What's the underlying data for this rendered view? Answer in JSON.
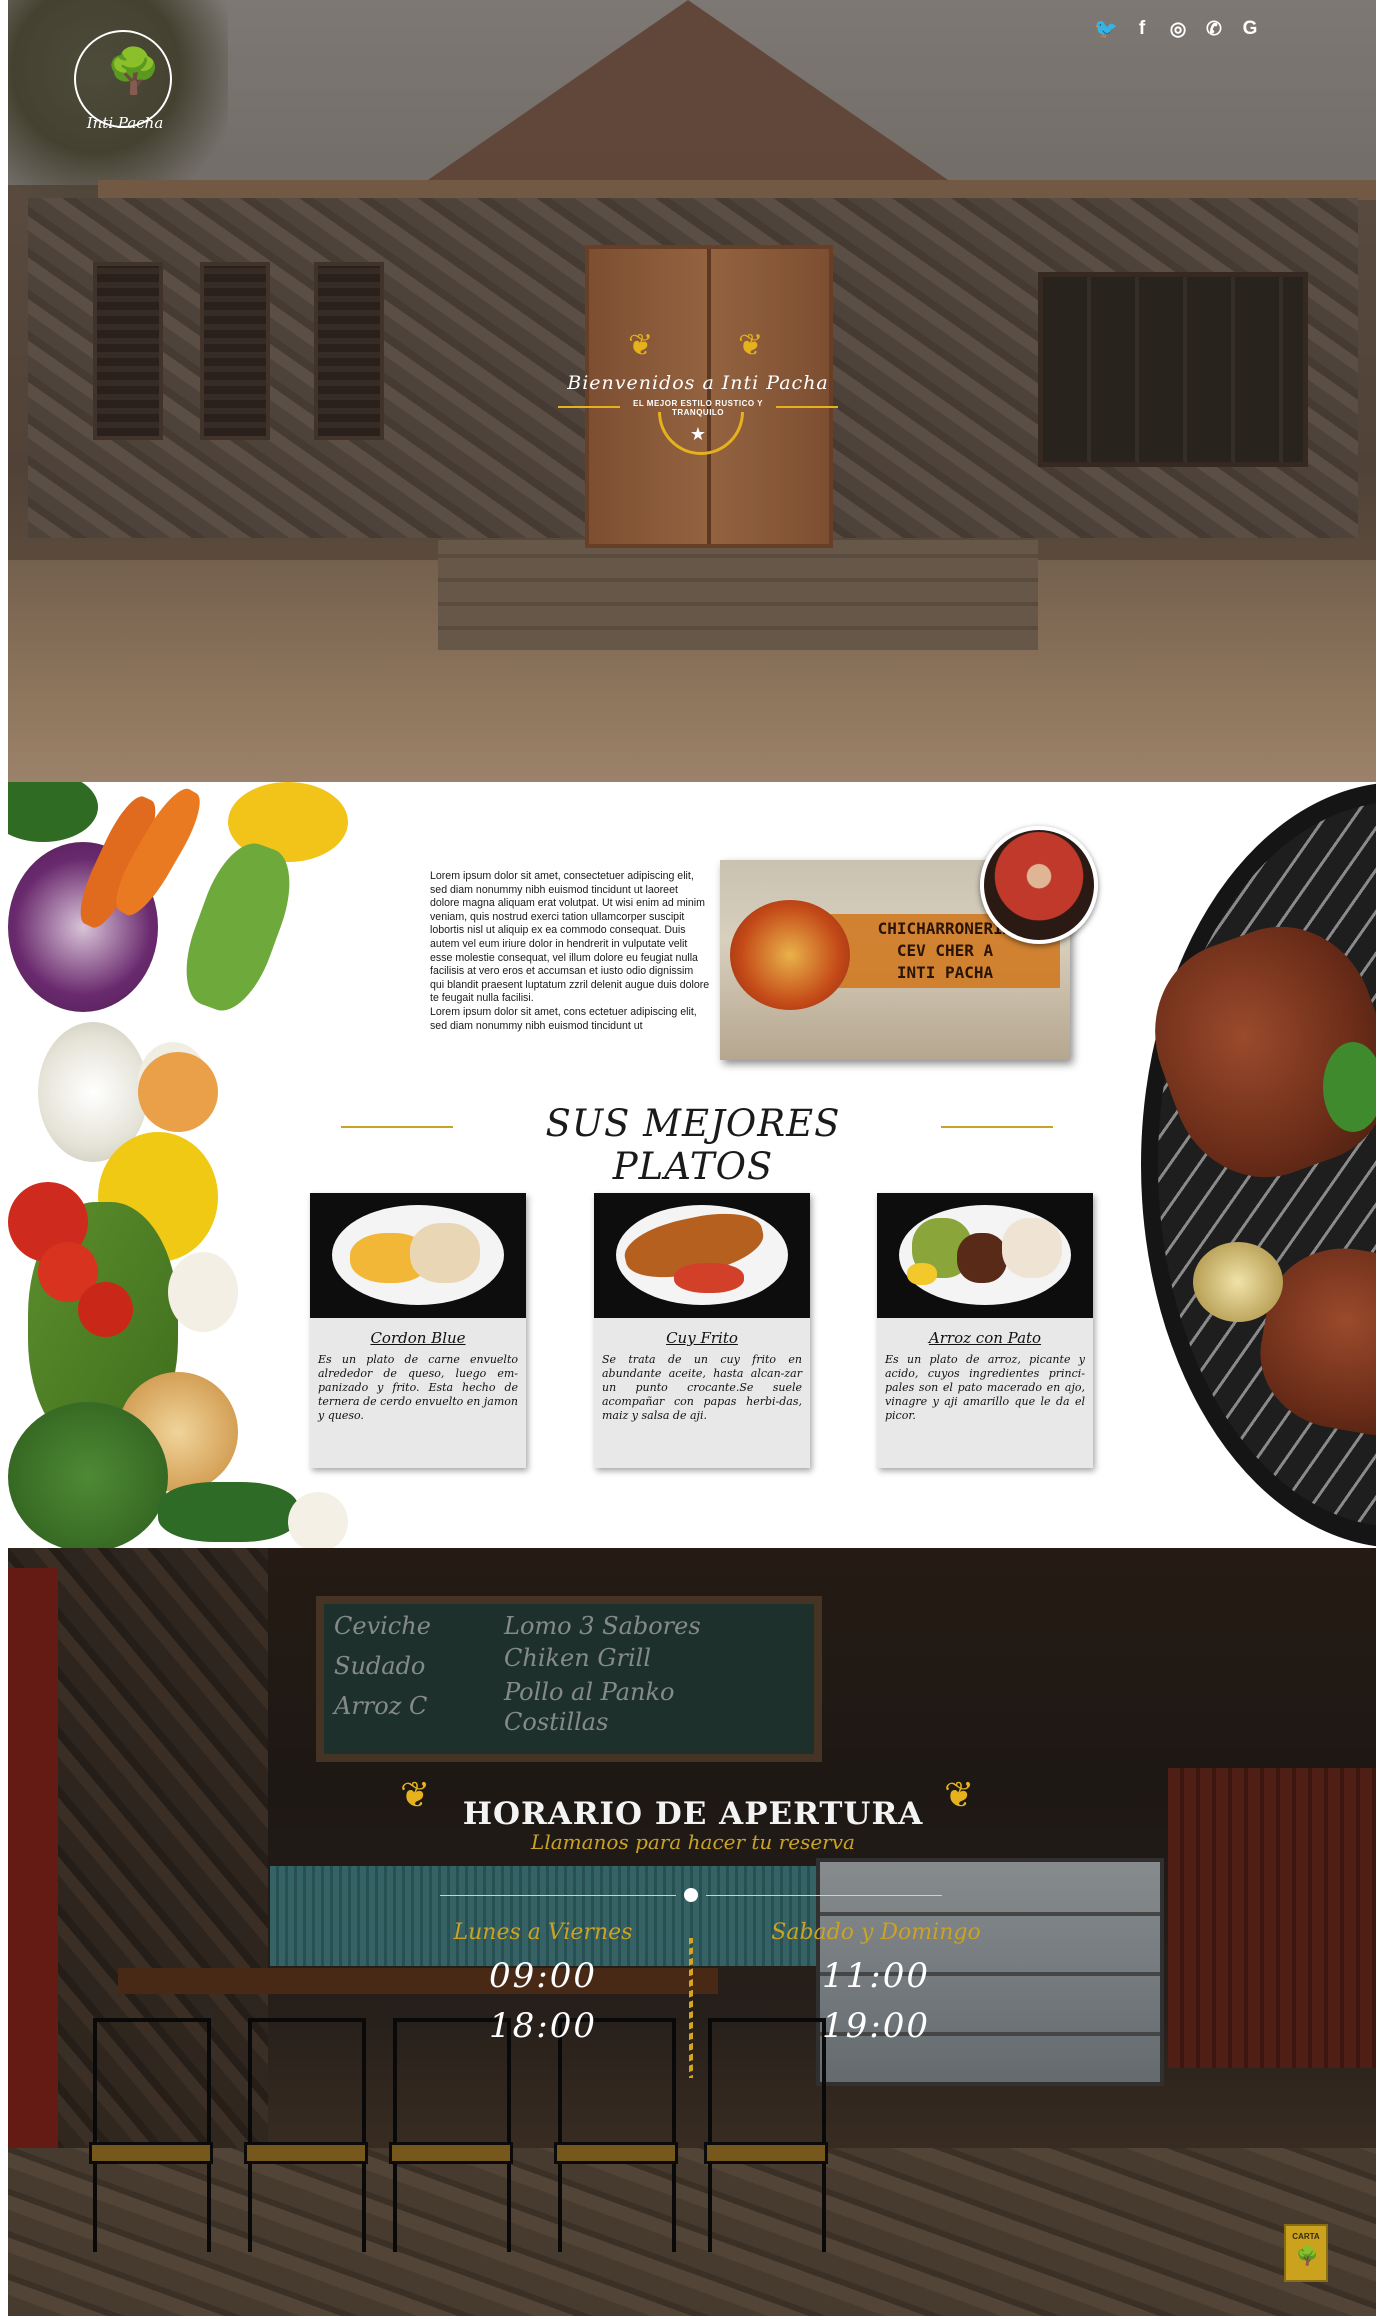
{
  "brand": {
    "name": "Inti Pacha"
  },
  "social": [
    {
      "icon": "twitter-icon",
      "glyph": "🐦"
    },
    {
      "icon": "facebook-icon",
      "glyph": "f"
    },
    {
      "icon": "instagram-icon",
      "glyph": "◎"
    },
    {
      "icon": "whatsapp-icon",
      "glyph": "✆"
    },
    {
      "icon": "google-icon",
      "glyph": "G"
    }
  ],
  "hero": {
    "title": "Bienvenidos a Inti Pacha",
    "subtitle": "EL MEJOR ESTILO RUSTICO Y TRANQUILO"
  },
  "about": {
    "paragraph1": "Lorem ipsum dolor sit amet, consectetuer adipiscing elit, sed diam nonummy nibh euismod tincidunt ut laoreet dolore magna aliquam erat volutpat. Ut wisi enim ad minim veniam, quis nostrud exerci tation ullamcorper suscipit lobortis nisl ut aliquip ex ea commodo consequat. Duis autem vel eum iriure dolor in hendrerit in vulputate velit esse molestie consequat, vel illum dolore eu feugiat nulla facilisis at vero eros et accumsan et iusto odio dignissim qui blandit praesent luptatum zzril delenit augue duis dolore te feugait nulla facilisi.",
    "paragraph2": "Lorem ipsum dolor sit amet, cons ectetuer adipiscing elit, sed diam nonummy nibh euismod tincidunt ut",
    "sign_line1": "CHICHARRONERIA",
    "sign_line2": "CEV CHER A",
    "sign_line3": "INTI PACHA"
  },
  "dishes_section": {
    "title": "SUS MEJORES PLATOS",
    "items": [
      {
        "name": "Cordon Blue",
        "description": "Es un plato de carne envuelto alrededor de queso, luego em-panizado y frito. Esta hecho de ternera de cerdo envuelto en jamon y queso."
      },
      {
        "name": "Cuy Frito",
        "description": "Se trata de un cuy frito en abundante aceite, hasta alcan-zar un punto crocante.Se suele acompañar con papas herbi-das, maiz y salsa de aji."
      },
      {
        "name": "Arroz con Pato",
        "description": "Es un plato de arroz, picante y acido, cuyos ingredientes princi-pales son el pato macerado en ajo, vinagre y aji amarillo que le da el picor."
      }
    ]
  },
  "hours": {
    "title": "HORARIO DE APERTURA",
    "subtitle": "Llamanos para hacer tu reserva",
    "weekdays": {
      "label": "Lunes a Viernes",
      "open": "09:00",
      "close": "18:00"
    },
    "weekend": {
      "label": "Sabado y Domingo",
      "open": "11:00",
      "close": "19:00"
    },
    "board": [
      "Ceviche",
      "Sudado",
      "Arroz C",
      "Lomo 3 Sabores",
      "Chiken Grill",
      "Pollo al Panko",
      "Costillas"
    ]
  },
  "carta": {
    "label": "CARTA"
  },
  "colors": {
    "gold": "#c9a227",
    "accent": "#e5b11c"
  }
}
